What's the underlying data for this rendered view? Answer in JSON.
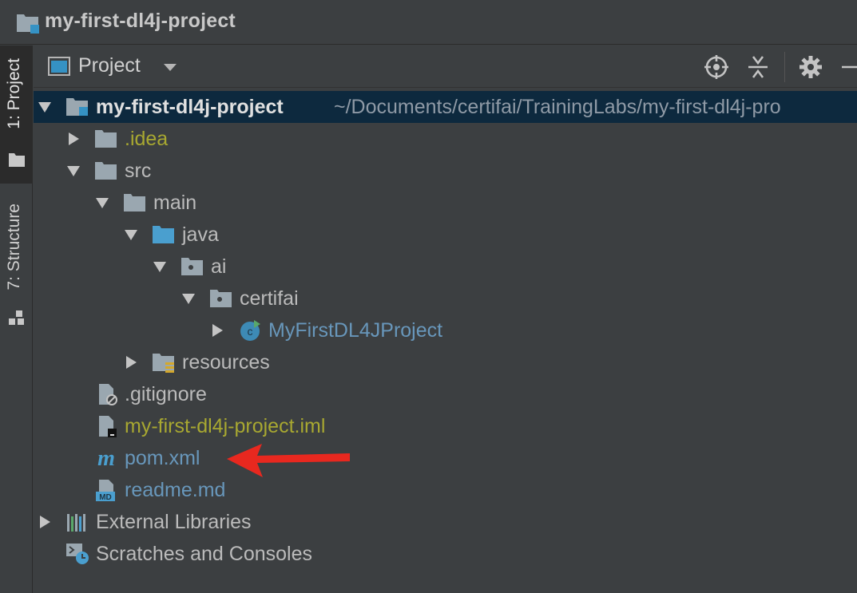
{
  "window": {
    "title": "my-first-dl4j-project"
  },
  "side_tabs": [
    {
      "label": "1: Project",
      "active": true
    },
    {
      "label": "7: Structure",
      "active": false
    }
  ],
  "toolbar": {
    "view_label": "Project",
    "buttons": [
      "locate-icon",
      "collapse-all-icon",
      "gear-icon",
      "minimize-icon"
    ]
  },
  "tree": {
    "root": {
      "label": "my-first-dl4j-project",
      "path": "~/Documents/certifai/TrainingLabs/my-first-dl4j-pro"
    },
    "nodes": [
      {
        "label": ".idea"
      },
      {
        "label": "src"
      },
      {
        "label": "main"
      },
      {
        "label": "java"
      },
      {
        "label": "ai"
      },
      {
        "label": "certifai"
      },
      {
        "label": "MyFirstDL4JProject"
      },
      {
        "label": "resources"
      },
      {
        "label": ".gitignore"
      },
      {
        "label": "my-first-dl4j-project.iml"
      },
      {
        "label": "pom.xml"
      },
      {
        "label": "readme.md"
      },
      {
        "label": "External Libraries"
      },
      {
        "label": "Scratches and Consoles"
      }
    ]
  },
  "colors": {
    "background": "#3c3f41",
    "selection": "#0d293e",
    "excluded_text": "#a8a831",
    "file_blue": "#6897bb",
    "annotation_arrow": "#e8281f"
  }
}
